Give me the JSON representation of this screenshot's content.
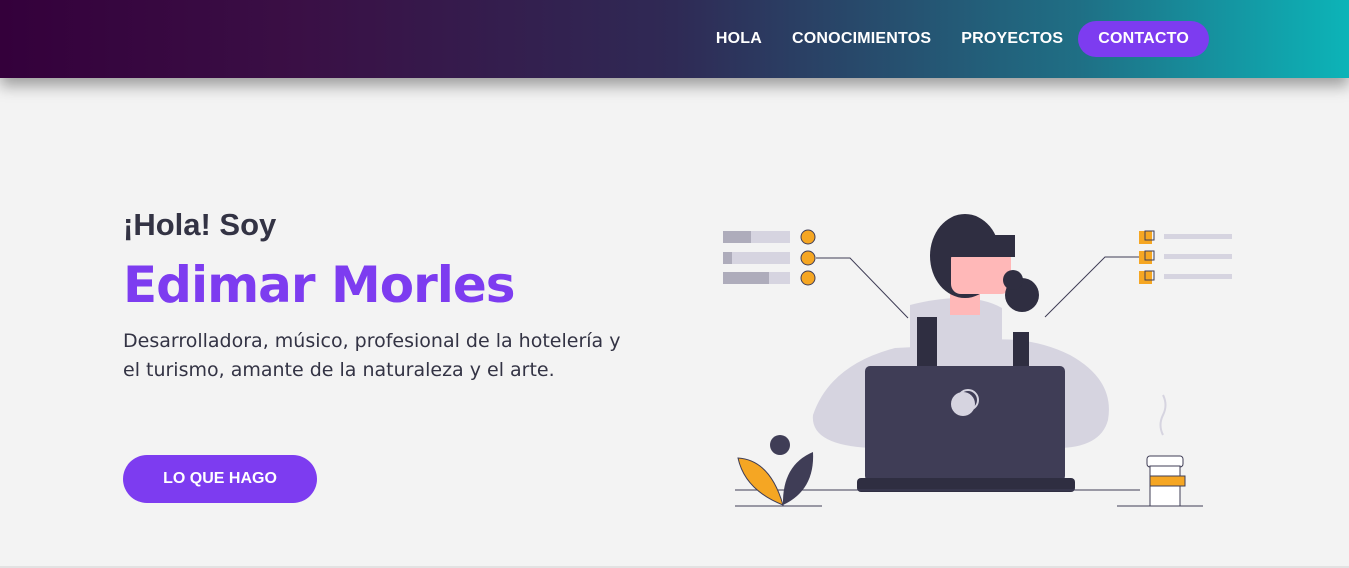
{
  "nav": {
    "links": [
      {
        "label": "HOLA"
      },
      {
        "label": "CONOCIMIENTOS"
      },
      {
        "label": "PROYECTOS"
      }
    ],
    "cta_label": "CONTACTO"
  },
  "hero": {
    "greeting": "¡Hola! Soy",
    "name": "Edimar Morles",
    "description": "Desarrolladora, músico, profesional de la hotelería y el turismo, amante de la naturaleza y el arte.",
    "button_label": "LO QUE HAGO"
  },
  "colors": {
    "accent": "#7d3cf0",
    "text": "#333344",
    "background": "#f3f3f3",
    "illustration_dark": "#3f3d56",
    "illustration_orange": "#f5a623"
  }
}
